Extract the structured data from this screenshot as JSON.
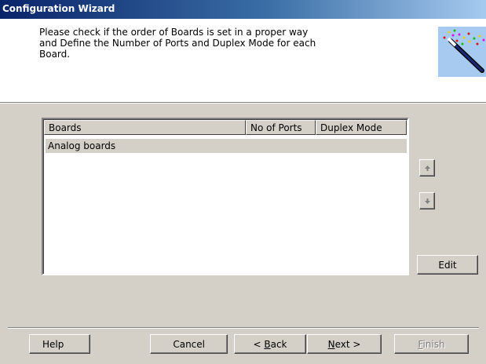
{
  "window": {
    "title": "Configuration Wizard"
  },
  "header": {
    "description_lines": [
      "Please check if the order of Boards is set in a proper way",
      "and Define the Number of Ports and Duplex Mode for each",
      "Board."
    ],
    "icon": "magic-wand-icon"
  },
  "table": {
    "columns": [
      "Boards",
      "No of Ports",
      "Duplex Mode"
    ],
    "rows": [
      {
        "boards": "Analog boards",
        "ports": "",
        "duplex": ""
      }
    ]
  },
  "side_buttons": {
    "up_icon": "arrow-up-icon",
    "down_icon": "arrow-down-icon",
    "edit_label": "Edit"
  },
  "footer": {
    "help_label": "Help",
    "cancel_label": "Cancel",
    "back_prefix": "< ",
    "back_accel": "B",
    "back_rest": "ack",
    "next_accel": "N",
    "next_rest": "ext >",
    "finish_accel": "F",
    "finish_rest": "inish"
  }
}
